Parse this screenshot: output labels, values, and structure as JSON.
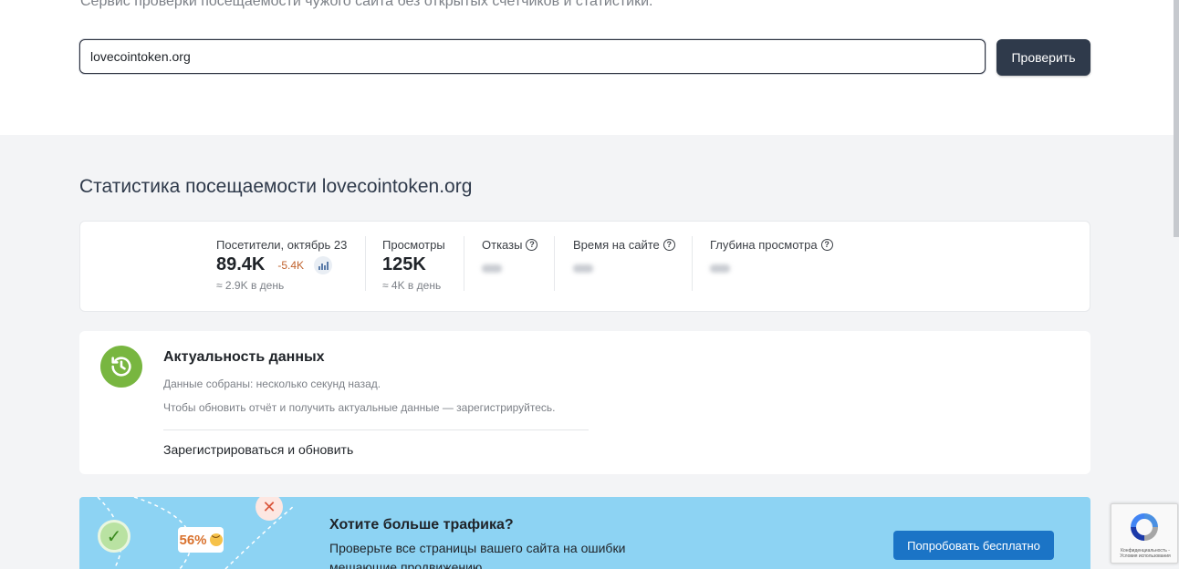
{
  "header": {
    "subtitle": "Сервис проверки посещаемости чужого сайта без открытых счетчиков и статистики."
  },
  "search": {
    "value": "lovecointoken.org",
    "button_label": "Проверить"
  },
  "stats": {
    "title": "Статистика посещаемости lovecointoken.org",
    "items": [
      {
        "label": "Посетители, октябрь 23",
        "value": "89.4K",
        "delta": "-5.4K",
        "sub": "≈ 2.9K в день"
      },
      {
        "label": "Просмотры",
        "value": "125K",
        "sub": "≈ 4K в день"
      },
      {
        "label": "Отказы"
      },
      {
        "label": "Время на сайте"
      },
      {
        "label": "Глубина просмотра"
      }
    ]
  },
  "freshness": {
    "title": "Актуальность данных",
    "collected": "Данные собраны: несколько секунд назад.",
    "hint": "Чтобы обновить отчёт и получить актуальные данные — зарегистрируйтесь.",
    "register_link": "Зарегистрироваться и обновить"
  },
  "promo": {
    "title": "Хотите больше трафика?",
    "text": "Проверьте все страницы вашего сайта на ошибки мешающие продвижению",
    "percent": "56%",
    "button_label": "Попробовать бесплатно"
  },
  "recaptcha": {
    "text": "Конфиденциальность - Условия использования"
  },
  "colors": {
    "button_dark": "#2f3a4b",
    "delta_negative": "#c0622d",
    "clock_green": "#78b640",
    "promo_bg": "#8dd3f3",
    "promo_button": "#1b74c6"
  }
}
